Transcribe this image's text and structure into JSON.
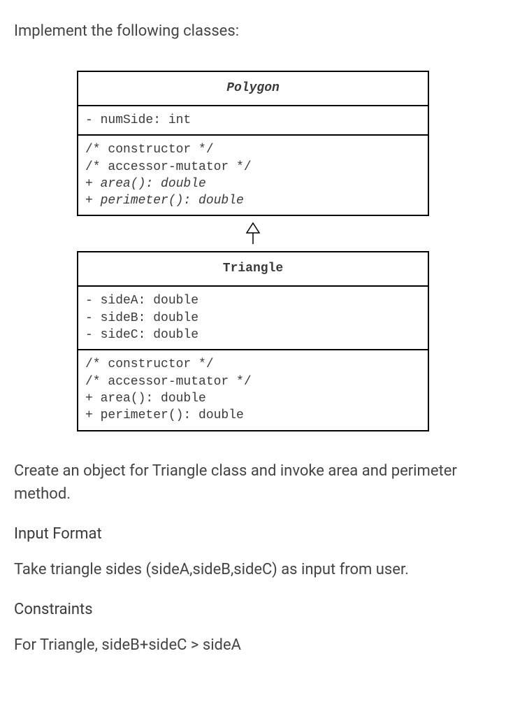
{
  "intro": "Implement the following classes:",
  "uml": {
    "polygon": {
      "name": "Polygon",
      "attr1": "- numSide: int",
      "op1": "/* constructor */",
      "op2": "/* accessor-mutator */",
      "op3": "+ area(): double",
      "op4": "+ perimeter(): double"
    },
    "triangle": {
      "name": "Triangle",
      "attr1": "- sideA: double",
      "attr2": "- sideB: double",
      "attr3": "- sideC: double",
      "op1": "/* constructor */",
      "op2": "/* accessor-mutator */",
      "op3": "+ area(): double",
      "op4": "+ perimeter(): double"
    }
  },
  "instruction": "Create an object for Triangle class and invoke area and perimeter method.",
  "inputFormatHeading": "Input Format",
  "inputFormatText": "Take triangle sides (sideA,sideB,sideC) as input from user.",
  "constraintsHeading": "Constraints",
  "constraintsText": "For Triangle, sideB+sideC > sideA"
}
